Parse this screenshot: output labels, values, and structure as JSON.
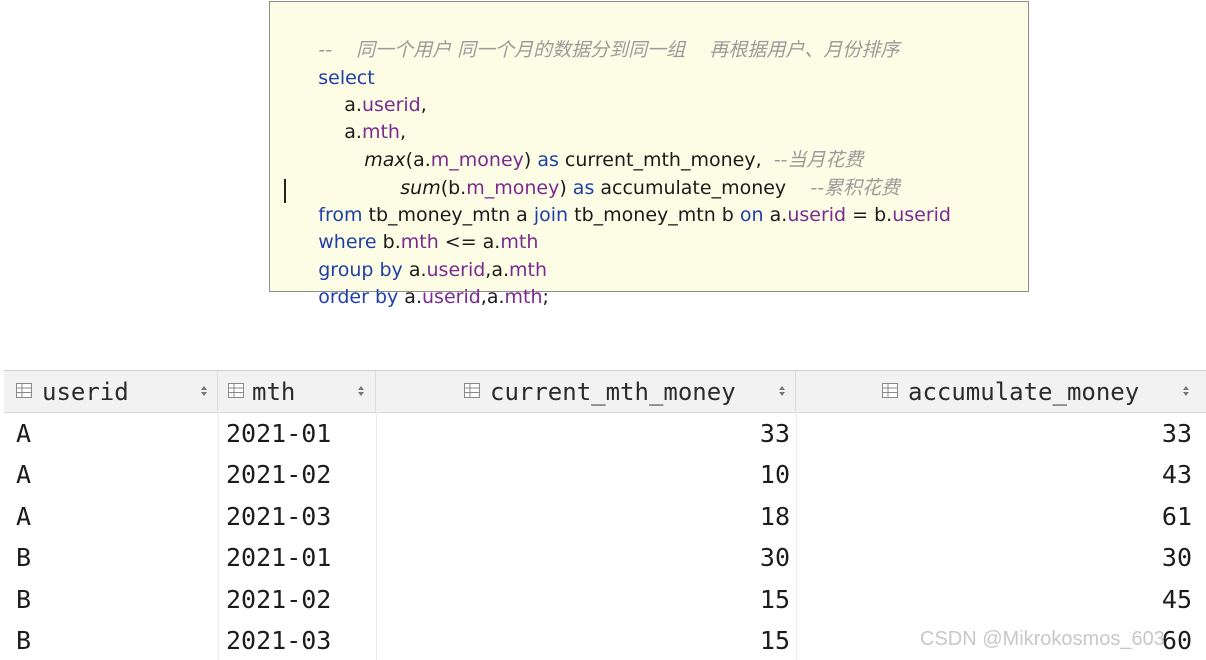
{
  "sql": {
    "comment_header": "--    同一个用户 同一个月的数据分到同一组    再根据用户、月份排序",
    "select_kw": "select",
    "l2_tbl": "a.",
    "l2_col": "userid",
    "l2_comma": ",",
    "l3_tbl": "a.",
    "l3_col": "mth",
    "l3_comma": ",",
    "l4_fn": "max",
    "l4_open": "(a.",
    "l4_col": "m_money",
    "l4_close": ") ",
    "l4_as": "as",
    "l4_alias": " current_mth_money,  ",
    "l4_comment": "--当月花费",
    "l5_fn": "sum",
    "l5_open": "(b.",
    "l5_col": "m_money",
    "l5_close": ") ",
    "l5_as": "as",
    "l5_alias": " accumulate_money    ",
    "l5_comment": "--累积花费",
    "l6_from": "from",
    "l6_t1": " tb_money_mtn a ",
    "l6_join": "join",
    "l6_t2": " tb_money_mtn b ",
    "l6_on": "on",
    "l6_a": " a.",
    "l6_acol": "userid",
    "l6_eq": " = b.",
    "l6_bcol": "userid",
    "l7_where": "where",
    "l7_b": " b.",
    "l7_bcol": "mth",
    "l7_op": " <= a.",
    "l7_acol": "mth",
    "l8_group": "group by",
    "l8_a": " a.",
    "l8_acol": "userid",
    "l8_mid": ",a.",
    "l8_bcol": "mth",
    "l9_order": "order by",
    "l9_a": " a.",
    "l9_acol": "userid",
    "l9_mid": ",a.",
    "l9_bcol": "mth",
    "l9_end": ";"
  },
  "grid": {
    "columns": [
      "userid",
      "mth",
      "current_mth_money",
      "accumulate_money"
    ],
    "rows": [
      [
        "A",
        "2021-01",
        "33",
        "33"
      ],
      [
        "A",
        "2021-02",
        "10",
        "43"
      ],
      [
        "A",
        "2021-03",
        "18",
        "61"
      ],
      [
        "B",
        "2021-01",
        "30",
        "30"
      ],
      [
        "B",
        "2021-02",
        "15",
        "45"
      ],
      [
        "B",
        "2021-03",
        "15",
        "60"
      ]
    ]
  },
  "watermark": "CSDN @Mikrokosmos_603",
  "colors": {
    "keyword": "#1e3fa6",
    "column": "#7a2a8f",
    "comment": "#9a9a9a",
    "panel_bg": "#fdfde6"
  },
  "icons": {
    "column_icon": "table-column-icon",
    "sort_icon": "sort-arrows-icon"
  }
}
